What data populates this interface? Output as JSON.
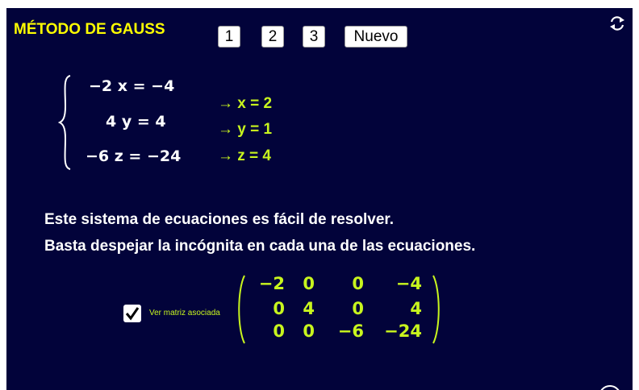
{
  "title": "MÉTODO DE GAUSS",
  "buttons": [
    "1",
    "2",
    "3",
    "Nuevo"
  ],
  "equations": [
    "−2 x = −4",
    "4 y = 4",
    "−6 z = −24"
  ],
  "solutions": [
    "→ x = 2",
    "→ y = 1",
    "→ z = 4"
  ],
  "description": [
    "Este sistema de ecuaciones es fácil de resolver.",
    "Basta despejar la incógnita en cada una de las ecuaciones."
  ],
  "checkbox": {
    "label": "Ver matriz asociada",
    "checked": true
  },
  "matrix": [
    [
      "−2",
      "0",
      "0",
      "−4"
    ],
    [
      "0",
      "4",
      "0",
      "4"
    ],
    [
      "0",
      "0",
      "−6",
      "−24"
    ]
  ],
  "colors": {
    "background": "#02033a",
    "title": "#ffff00",
    "accent": "#c8f51e",
    "text": "#ffffff"
  },
  "icons": {
    "reset": "refresh-icon"
  }
}
